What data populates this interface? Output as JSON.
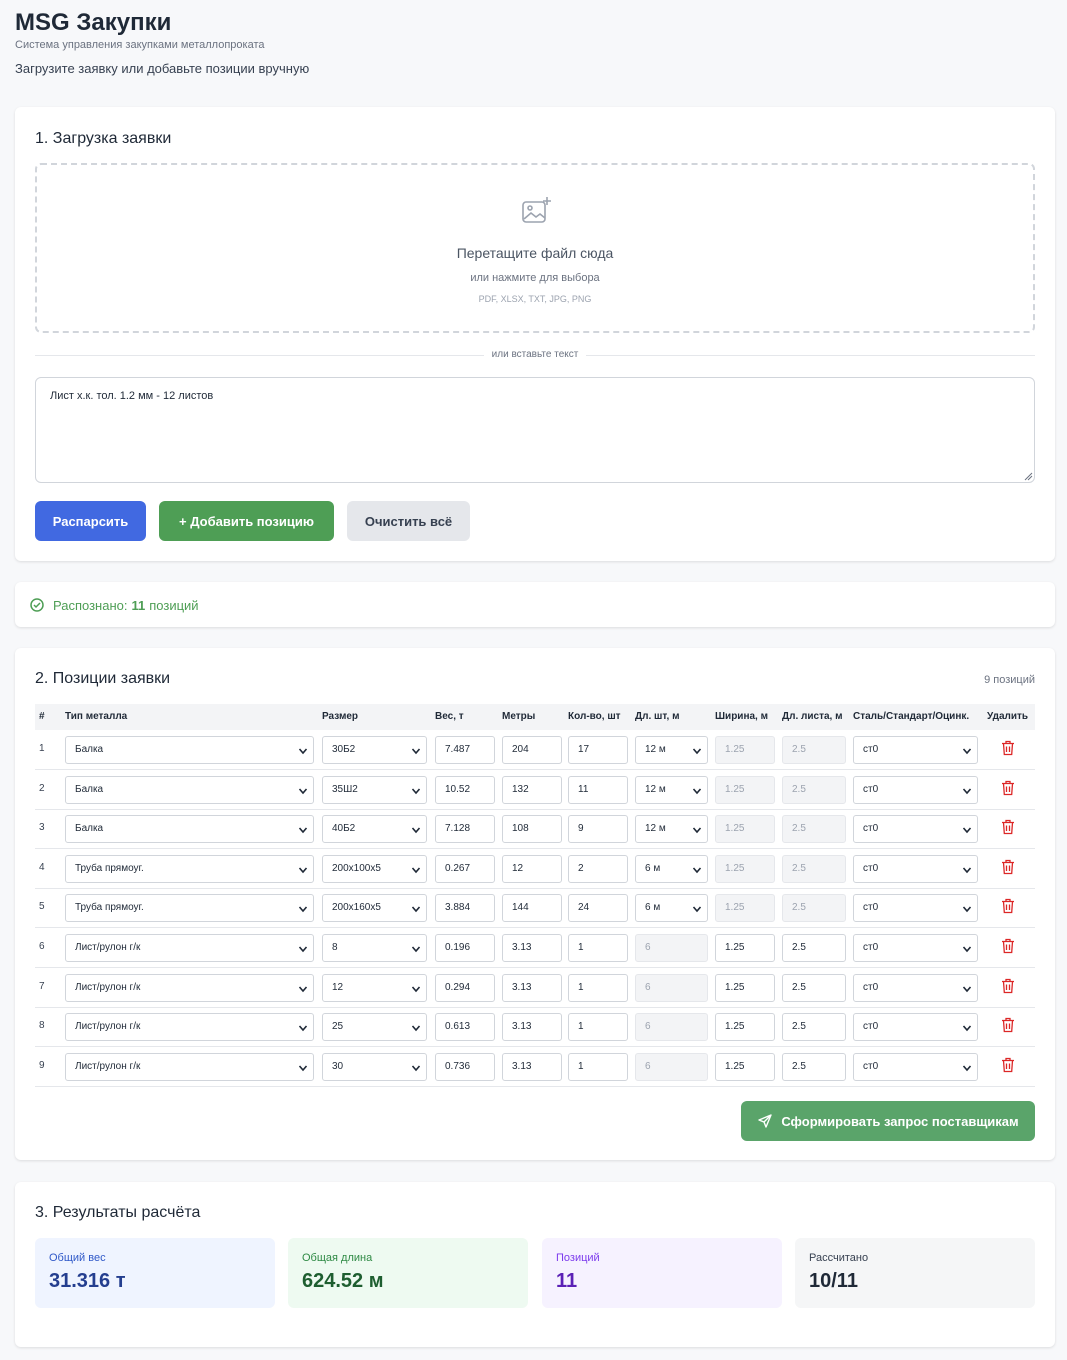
{
  "app": {
    "title": "MSG Закупки",
    "subtitle": "Система управления закупками металлопроката",
    "hint": "Загрузите заявку или добавьте позиции вручную"
  },
  "upload": {
    "title": "1. Загрузка заявки",
    "drop_title": "Перетащите файл сюда",
    "drop_sub": "или нажмите для выбора",
    "drop_formats": "PDF, XLSX, TXT, JPG, PNG",
    "divider": "или вставьте текст",
    "text_value": "Лист х.к. тол. 1.2 мм - 12 листов",
    "parse_label": "Распарсить",
    "add_label": "+ Добавить позицию",
    "clear_label": "Очистить всё"
  },
  "status": {
    "prefix": "Распознано:",
    "count": "11",
    "suffix": "позиций"
  },
  "items": {
    "title": "2. Позиции заявки",
    "count_label": "9 позиций",
    "headers": [
      "#",
      "Тип металла",
      "Размер",
      "Вес, т",
      "Метры",
      "Кол-во, шт",
      "Дл. шт, м",
      "Ширина, м",
      "Дл. листа, м",
      "Сталь/Стандарт/Оцинк.",
      "Удалить"
    ],
    "rows": [
      {
        "n": "1",
        "type": "Балка",
        "size": "30Б2",
        "weight": "7.487",
        "meters": "204",
        "qty": "17",
        "len": "12 м",
        "width": "1.25",
        "sheet_len": "2.5",
        "steel": "ст0"
      },
      {
        "n": "2",
        "type": "Балка",
        "size": "35Ш2",
        "weight": "10.52",
        "meters": "132",
        "qty": "11",
        "len": "12 м",
        "width": "1.25",
        "sheet_len": "2.5",
        "steel": "ст0"
      },
      {
        "n": "3",
        "type": "Балка",
        "size": "40Б2",
        "weight": "7.128",
        "meters": "108",
        "qty": "9",
        "len": "12 м",
        "width": "1.25",
        "sheet_len": "2.5",
        "steel": "ст0"
      },
      {
        "n": "4",
        "type": "Труба прямоуг.",
        "size": "200x100x5",
        "weight": "0.267",
        "meters": "12",
        "qty": "2",
        "len": "6 м",
        "width": "1.25",
        "sheet_len": "2.5",
        "steel": "ст0"
      },
      {
        "n": "5",
        "type": "Труба прямоуг.",
        "size": "200x160x5",
        "weight": "3.884",
        "meters": "144",
        "qty": "24",
        "len": "6 м",
        "width": "1.25",
        "sheet_len": "2.5",
        "steel": "ст0"
      },
      {
        "n": "6",
        "type": "Лист/рулон г/к",
        "size": "8",
        "weight": "0.196",
        "meters": "3.13",
        "qty": "1",
        "len": "6",
        "width": "1.25",
        "sheet_len": "2.5",
        "steel": "ст0"
      },
      {
        "n": "7",
        "type": "Лист/рулон г/к",
        "size": "12",
        "weight": "0.294",
        "meters": "3.13",
        "qty": "1",
        "len": "6",
        "width": "1.25",
        "sheet_len": "2.5",
        "steel": "ст0"
      },
      {
        "n": "8",
        "type": "Лист/рулон г/к",
        "size": "25",
        "weight": "0.613",
        "meters": "3.13",
        "qty": "1",
        "len": "6",
        "width": "1.25",
        "sheet_len": "2.5",
        "steel": "ст0"
      },
      {
        "n": "9",
        "type": "Лист/рулон г/к",
        "size": "30",
        "weight": "0.736",
        "meters": "3.13",
        "qty": "1",
        "len": "6",
        "width": "1.25",
        "sheet_len": "2.5",
        "steel": "ст0"
      }
    ],
    "send_label": "Сформировать запрос поставщикам"
  },
  "results": {
    "title": "3. Результаты расчёта",
    "stats": [
      {
        "label": "Общий вес",
        "value": "31.316 т"
      },
      {
        "label": "Общая длина",
        "value": "624.52 м"
      },
      {
        "label": "Позиций",
        "value": "11"
      },
      {
        "label": "Рассчитано",
        "value": "10/11"
      }
    ]
  },
  "colors": {
    "primary": "#4169e1",
    "success": "#4e9e55",
    "danger": "#dc2626"
  }
}
